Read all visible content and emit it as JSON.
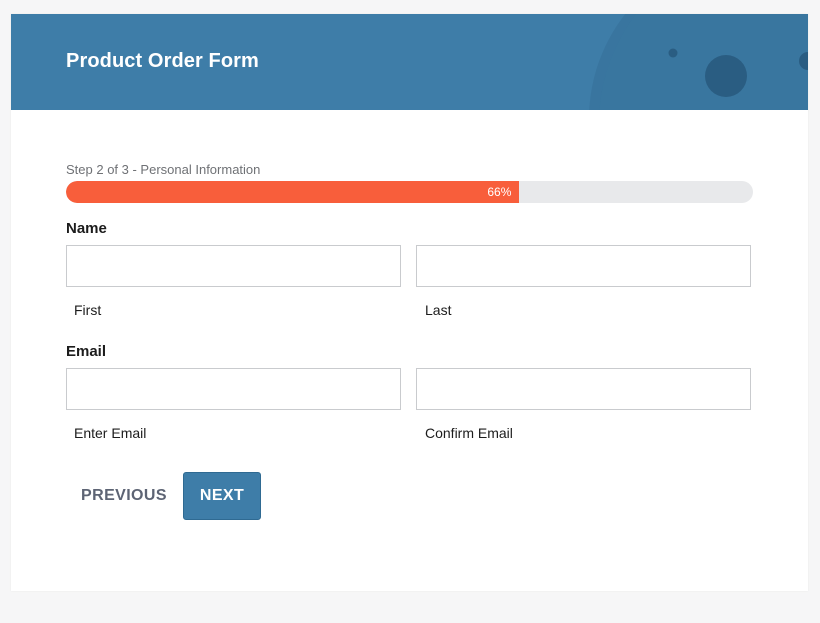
{
  "header": {
    "title": "Product Order Form",
    "background_color": "#3e7da8",
    "decoration": "planet-decoration"
  },
  "progress": {
    "step_text": "Step 2 of 3 - Personal Information",
    "percent": 66,
    "percent_label": "66%",
    "fill_color": "#f85e3b",
    "track_color": "#e8e9eb"
  },
  "name_section": {
    "label": "Name",
    "first": {
      "value": "",
      "sublabel": "First"
    },
    "last": {
      "value": "",
      "sublabel": "Last"
    }
  },
  "email_section": {
    "label": "Email",
    "enter": {
      "value": "",
      "sublabel": "Enter Email"
    },
    "confirm": {
      "value": "",
      "sublabel": "Confirm Email"
    }
  },
  "buttons": {
    "previous": "PREVIOUS",
    "next": "NEXT",
    "next_color": "#3e7da8"
  }
}
